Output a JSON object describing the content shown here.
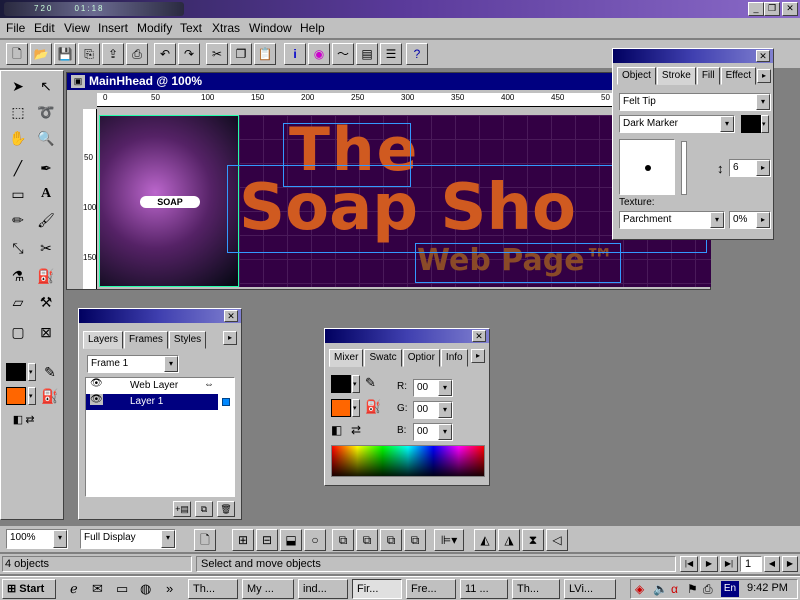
{
  "window": {
    "app_logo": "720",
    "minimize": "_",
    "restore": "❐",
    "close": "✕",
    "clock_small": "01:18"
  },
  "menu": [
    "File",
    "Edit",
    "View",
    "Insert",
    "Modify",
    "Text",
    "Xtras",
    "Window",
    "Help"
  ],
  "toolbar_icons": [
    "new-icon",
    "open-icon",
    "save-icon",
    "copy-icon",
    "import-icon",
    "print-icon",
    "undo-icon",
    "redo-icon",
    "cut-icon",
    "copy2-icon",
    "paste-icon",
    "info-icon",
    "color-icon",
    "stroke-icon",
    "fill-icon",
    "layers-icon",
    "help-icon"
  ],
  "document": {
    "title": "MainHhead @  100%",
    "hruler": [
      "0",
      "50",
      "100",
      "150",
      "200",
      "250",
      "300",
      "350",
      "400",
      "450",
      "50"
    ],
    "vruler": [
      "50",
      "100",
      "150"
    ],
    "title_word": "The",
    "headline": "Soap Sho",
    "subline": "Web Page™",
    "photo_label": "SOAP"
  },
  "stroke_panel": {
    "tabs": [
      "Object",
      "Stroke",
      "Fill",
      "Effect"
    ],
    "active_tab": "Stroke",
    "category": "Felt Tip",
    "type": "Dark Marker",
    "size": "6",
    "texture_label": "Texture:",
    "texture": "Parchment",
    "texture_amount": "0%"
  },
  "layers_panel": {
    "tabs": [
      "Layers",
      "Frames",
      "Styles"
    ],
    "frame": "Frame 1",
    "layers": [
      "Web Layer",
      "Layer 1"
    ]
  },
  "mixer_panel": {
    "tabs": [
      "Mixer",
      "Swatc",
      "Optior",
      "Info"
    ],
    "r_label": "R:",
    "g_label": "G:",
    "b_label": "B:",
    "r": "00",
    "g": "00",
    "b": "00"
  },
  "bottom": {
    "zoom": "100%",
    "display": "Full Display"
  },
  "status": {
    "objects": "4 objects",
    "hint": "Select and move objects",
    "frame_num": "1"
  },
  "taskbar": {
    "start": "Start",
    "tasks": [
      "Th...",
      "My ...",
      "ind...",
      "Fir...",
      "Fre...",
      "11 ...",
      "Th...",
      "LVi..."
    ],
    "active_task": 3,
    "time": "9:42 PM",
    "lang": "En"
  },
  "colors": {
    "stroke_fill": "#000000",
    "fill_color": "#ff6600",
    "headline": "#d05a20"
  }
}
